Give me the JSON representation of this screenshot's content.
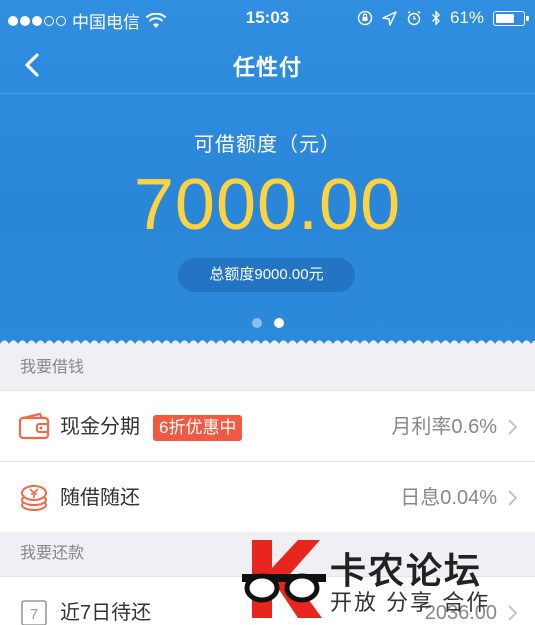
{
  "status_bar": {
    "carrier": "中国电信",
    "time": "15:03",
    "battery_percent": "61%",
    "icons": [
      "signal-dots",
      "wifi-icon",
      "lock-rotation-icon",
      "location-icon",
      "alarm-icon",
      "bluetooth-icon",
      "battery-icon"
    ]
  },
  "nav": {
    "title": "任性付",
    "back_icon": "chevron-left-icon"
  },
  "summary": {
    "available_label": "可借额度（元）",
    "available_amount": "7000.00",
    "total_limit": "总额度9000.00元",
    "pager": {
      "count": 2,
      "active_index": 1
    }
  },
  "borrow_section": {
    "header": "我要借钱",
    "rows": [
      {
        "icon": "wallet-icon",
        "title": "现金分期",
        "badge": "6折优惠中",
        "value": "月利率0.6%"
      },
      {
        "icon": "coin-stack-icon",
        "title": "随借随还",
        "value": "日息0.04%"
      }
    ]
  },
  "repay_section": {
    "header": "我要还款",
    "rows": [
      {
        "icon": "calendar-7-icon",
        "icon_text": "7",
        "title": "近7日待还",
        "value": "2036.00"
      }
    ]
  },
  "watermark": {
    "title": "卡农论坛",
    "subtitle": "开放 分享 合作"
  },
  "colors": {
    "header_blue": "#2a86d8",
    "amount_yellow": "#ffd23f",
    "badge_red": "#f05a43",
    "icon_red": "#f06a4a"
  }
}
